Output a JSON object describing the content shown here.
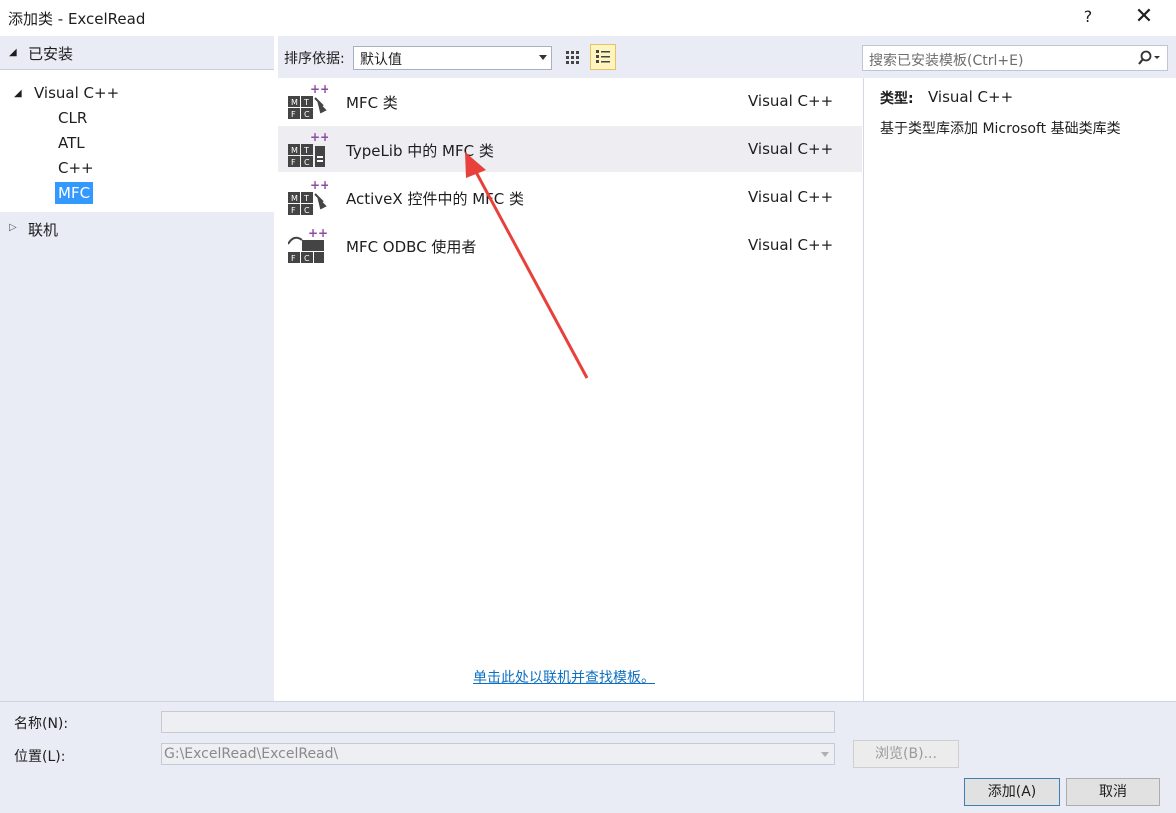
{
  "window": {
    "title": "添加类 - ExcelRead",
    "help_label": "?",
    "close_label": "✕"
  },
  "sidebar": {
    "header": "已安装",
    "tree": [
      {
        "label": "Visual C++"
      },
      {
        "label": "CLR"
      },
      {
        "label": "ATL"
      },
      {
        "label": "C++"
      },
      {
        "label": "MFC"
      }
    ],
    "online": "联机"
  },
  "toolbar": {
    "sort_label": "排序依据:",
    "sort_value": "默认值",
    "search_placeholder": "搜索已安装模板(Ctrl+E)"
  },
  "templates": [
    {
      "name": "MFC 类",
      "lang": "Visual C++"
    },
    {
      "name": "TypeLib 中的 MFC 类",
      "lang": "Visual C++"
    },
    {
      "name": "ActiveX 控件中的 MFC 类",
      "lang": "Visual C++"
    },
    {
      "name": "MFC ODBC 使用者",
      "lang": "Visual C++"
    }
  ],
  "online_link": "单击此处以联机并查找模板。",
  "details": {
    "type_key": "类型:",
    "type_value": "Visual C++",
    "description": "基于类型库添加 Microsoft 基础类库类"
  },
  "form": {
    "name_label": "名称(N):",
    "name_value": "",
    "location_label": "位置(L):",
    "location_value": "G:\\ExcelRead\\ExcelRead\\",
    "browse_label": "浏览(B)...",
    "add_label": "添加(A)",
    "cancel_label": "取消"
  },
  "colors": {
    "accent_selected": "#3399ff",
    "panel_bg": "#e9ecf5",
    "link": "#0e70c0",
    "annotation_arrow": "#e8403b",
    "icon_plus": "#8e4ba3"
  }
}
